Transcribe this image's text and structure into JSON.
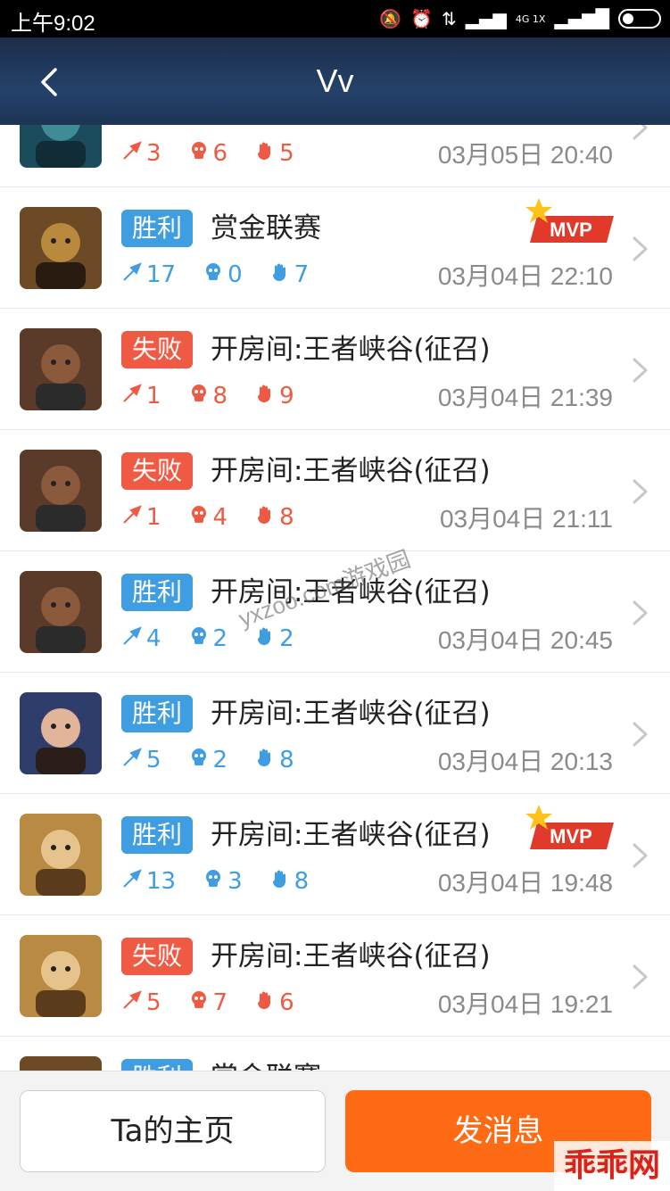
{
  "status_bar": {
    "time": "上午9:02",
    "network": "4G 1X"
  },
  "header": {
    "title": "Vv"
  },
  "matches": [
    {
      "result": "",
      "result_type": "lose",
      "mode": "",
      "kills": "3",
      "deaths": "6",
      "assists": "5",
      "time": "03月05日 20:40",
      "mvp": false,
      "avatar": "armored-hero"
    },
    {
      "result": "胜利",
      "result_type": "win",
      "mode": "赏金联赛",
      "kills": "17",
      "deaths": "0",
      "assists": "7",
      "time": "03月04日 22:10",
      "mvp": true,
      "avatar": "bearded-warrior"
    },
    {
      "result": "失败",
      "result_type": "lose",
      "mode": "开房间:王者峡谷(征召)",
      "kills": "1",
      "deaths": "8",
      "assists": "9",
      "time": "03月04日 21:39",
      "mvp": false,
      "avatar": "dark-warrior"
    },
    {
      "result": "失败",
      "result_type": "lose",
      "mode": "开房间:王者峡谷(征召)",
      "kills": "1",
      "deaths": "4",
      "assists": "8",
      "time": "03月04日 21:11",
      "mvp": false,
      "avatar": "dark-warrior"
    },
    {
      "result": "胜利",
      "result_type": "win",
      "mode": "开房间:王者峡谷(征召)",
      "kills": "4",
      "deaths": "2",
      "assists": "2",
      "time": "03月04日 20:45",
      "mvp": false,
      "avatar": "dark-warrior"
    },
    {
      "result": "胜利",
      "result_type": "win",
      "mode": "开房间:王者峡谷(征召)",
      "kills": "5",
      "deaths": "2",
      "assists": "8",
      "time": "03月04日 20:13",
      "mvp": false,
      "avatar": "girl-hero"
    },
    {
      "result": "胜利",
      "result_type": "win",
      "mode": "开房间:王者峡谷(征召)",
      "kills": "13",
      "deaths": "3",
      "assists": "8",
      "time": "03月04日 19:48",
      "mvp": true,
      "avatar": "goddess-hero"
    },
    {
      "result": "失败",
      "result_type": "lose",
      "mode": "开房间:王者峡谷(征召)",
      "kills": "5",
      "deaths": "7",
      "assists": "6",
      "time": "03月04日 19:21",
      "mvp": false,
      "avatar": "goddess-hero"
    },
    {
      "result": "胜利",
      "result_type": "win",
      "mode": "赏金联赛",
      "kills": "",
      "deaths": "",
      "assists": "",
      "time": "",
      "mvp": false,
      "avatar": "bearded-warrior"
    }
  ],
  "mvp_label": "MVP",
  "buttons": {
    "home": "Ta的主页",
    "message": "发消息"
  },
  "watermark": "yxzoo.com游戏园",
  "site_logo": "乖乖网",
  "colors": {
    "win": "#3f9de2",
    "lose": "#ee5a43",
    "primary": "#ff6a14"
  }
}
